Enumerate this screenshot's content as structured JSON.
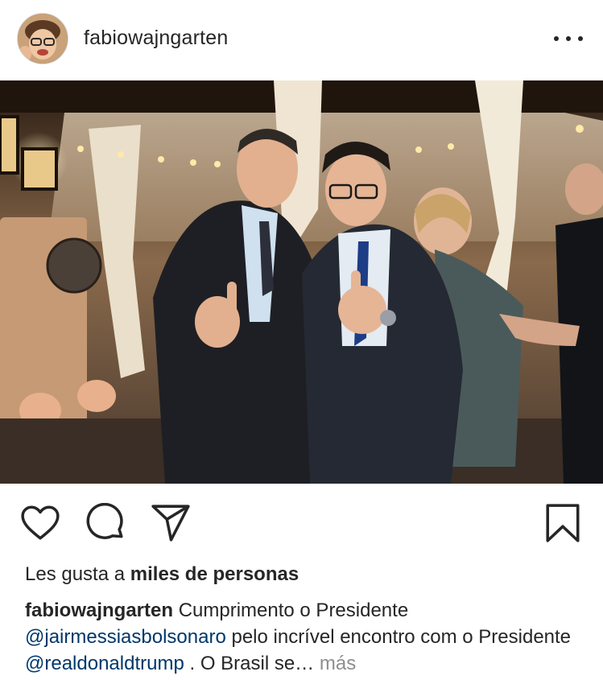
{
  "post": {
    "username": "fabiowajngarten",
    "more_options_icon": "ellipsis-icon"
  },
  "actions": {
    "like_icon": "heart-icon",
    "comment_icon": "comment-icon",
    "share_icon": "paper-plane-icon",
    "save_icon": "bookmark-icon"
  },
  "likes": {
    "prefix": "Les gusta a ",
    "count_text": "miles de personas"
  },
  "caption": {
    "username": "fabiowajngarten",
    "text_1": " Cumprimento o Presidente",
    "mention_1": "@jairmessiasbolsonaro",
    "text_2": " pelo incrível encontro com o Presidente ",
    "mention_2": "@realdonaldtrump",
    "text_3": " . O Brasil se…",
    "more_label": " más"
  }
}
